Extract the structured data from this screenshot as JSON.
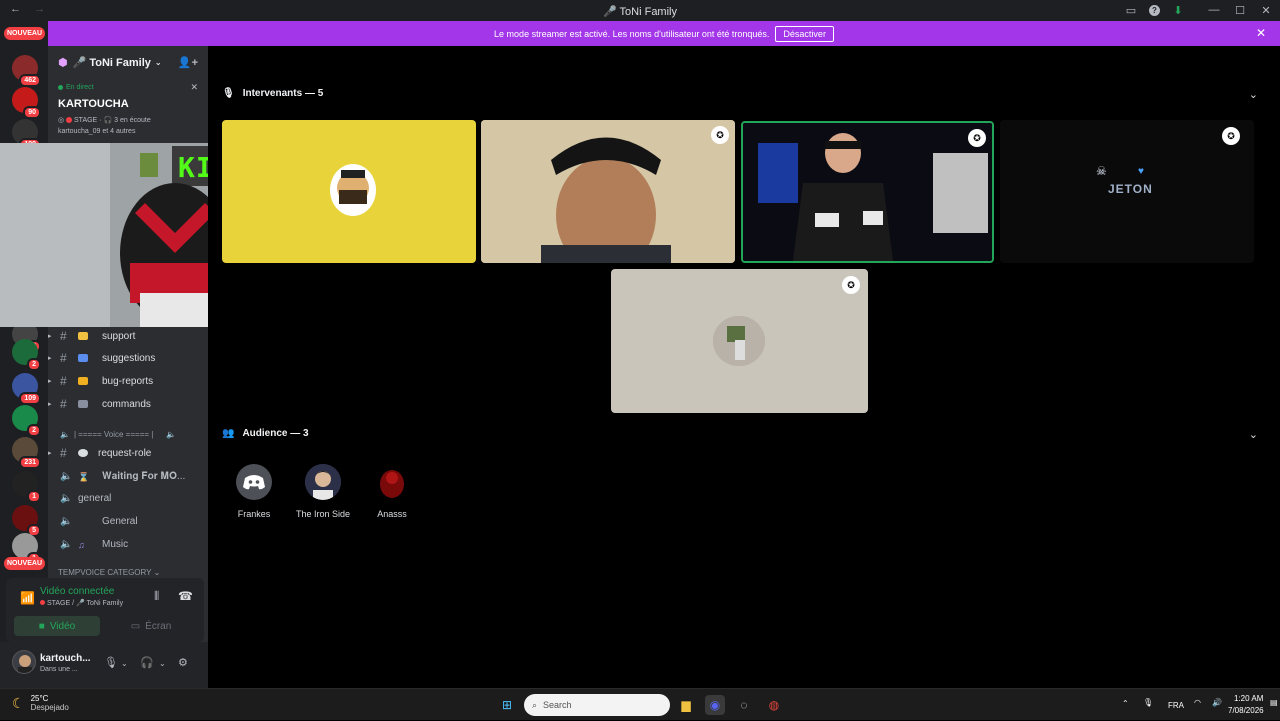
{
  "window": {
    "title": "🎤 ToNi Family",
    "nav_back": "←",
    "nav_forward": "→"
  },
  "banner": {
    "text": "Le mode streamer est activé. Les noms d'utilisateur ont été tronqués.",
    "button": "Désactiver"
  },
  "guilds": {
    "nouveau_top": "NOUVEAU",
    "nouveau_bottom": "NOUVEAU",
    "badges": [
      "462",
      "90",
      "199",
      "3",
      "2",
      "109",
      "2",
      "231",
      "1",
      "5",
      "1"
    ]
  },
  "sidebar": {
    "server_name": "🎤 ToNi Family",
    "live_label": "En direct",
    "event_name": "KARTOUCHA",
    "event_stage": "STAGE",
    "event_listeners": "3 en écoute",
    "event_people": "kartoucha_09 et 4 autres",
    "channels": [
      {
        "label": "support"
      },
      {
        "label": "suggestions"
      },
      {
        "label": "bug-reports"
      },
      {
        "label": "commands"
      },
      {
        "label": "| ===== Voice ===== |"
      },
      {
        "label": "request-role"
      },
      {
        "label": "𝐖𝐚𝐢𝐭𝐢𝐧𝐠 𝐅𝐨𝐫 𝐌𝐎..."
      },
      {
        "label": "general"
      },
      {
        "label": "General"
      },
      {
        "label": "Music"
      }
    ],
    "category": "TEMPVOICE CATEGORY"
  },
  "voice": {
    "state": "Vidéo connectée",
    "location": "STAGE / 🎤 ToNi Family",
    "video_label": "Vidéo",
    "screen_label": "Écran"
  },
  "user": {
    "name": "kartouch...",
    "status": "Dans une ..."
  },
  "stage": {
    "speakers_title": "Intervenants — 5",
    "audience_title": "Audience — 3",
    "jeton_text": "JETON",
    "kick_text": "KICK",
    "audience": [
      {
        "name": "Frankes"
      },
      {
        "name": "The Iron Side"
      },
      {
        "name": "Anasss"
      }
    ]
  },
  "taskbar": {
    "temp": "25°C",
    "weather": "Despejado",
    "search_placeholder": "Search",
    "lang": "FRA",
    "time": "1:20 AM",
    "date": "7/08/2026"
  },
  "colors": {
    "accent": "#a236e8",
    "online": "#23a55a",
    "danger": "#f23f43",
    "speaking": "#23a55a"
  }
}
